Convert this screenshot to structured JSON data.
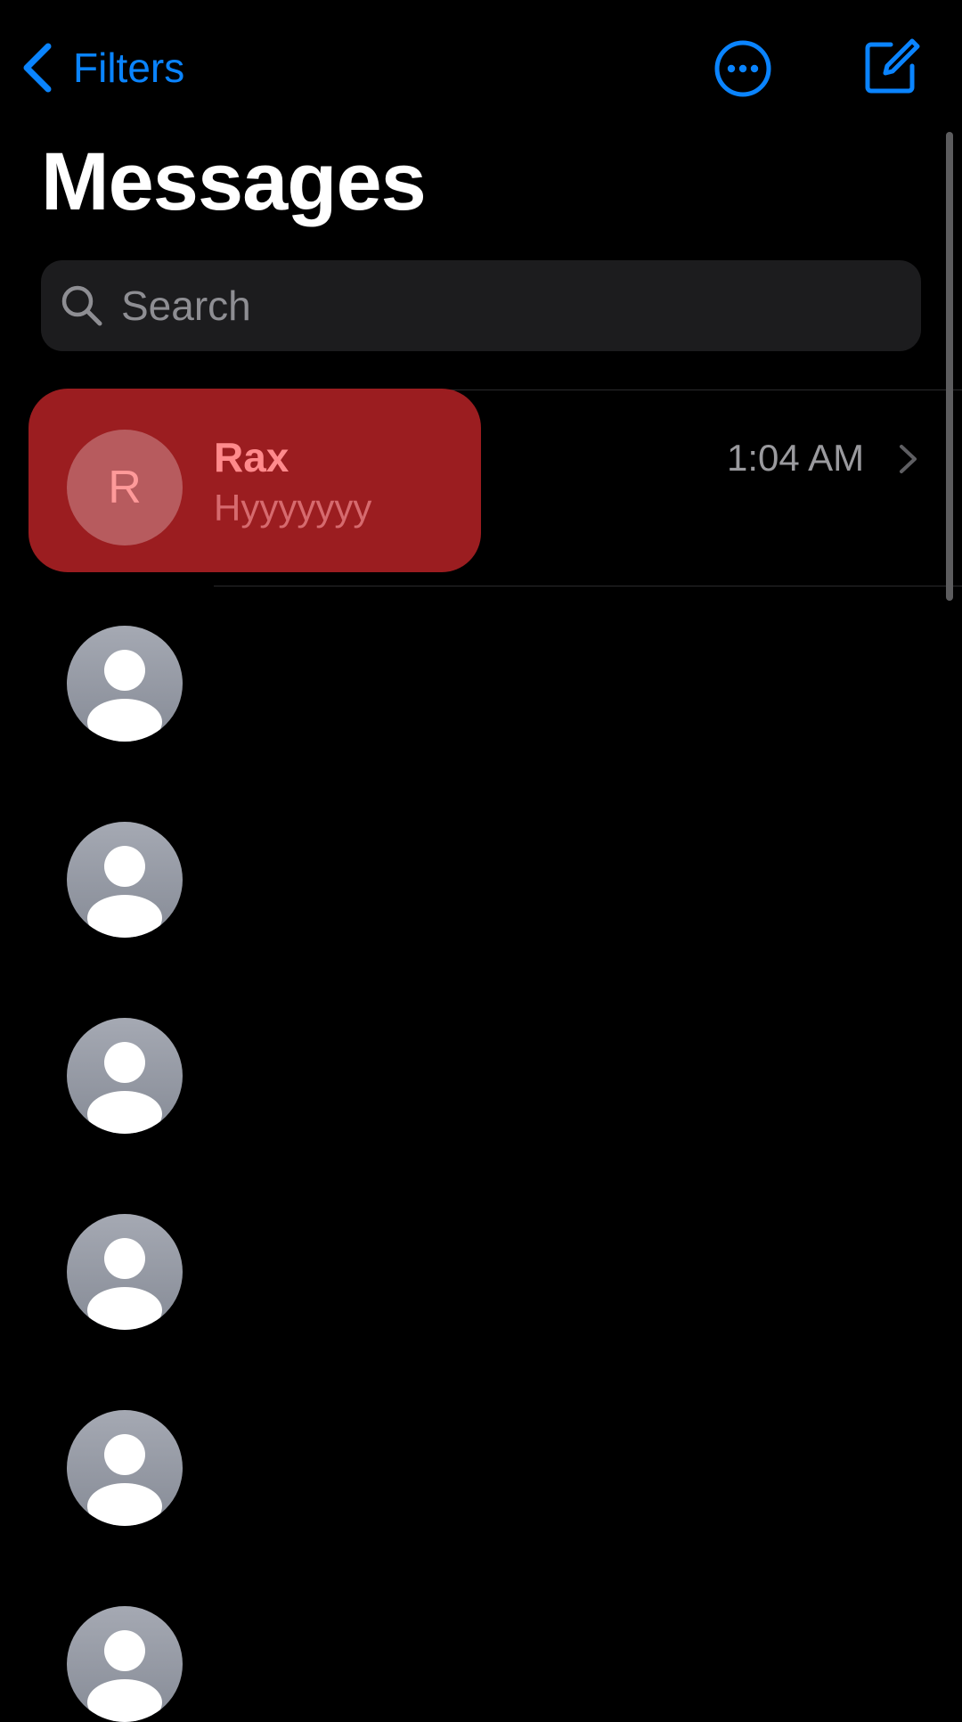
{
  "nav": {
    "back_label": "Filters",
    "more_icon": "ellipsis-circle-icon",
    "compose_icon": "compose-icon"
  },
  "page": {
    "title": "Messages"
  },
  "search": {
    "placeholder": "Search"
  },
  "colors": {
    "accent": "#0a84ff",
    "highlight": "#9b1d20",
    "background": "#000000"
  },
  "conversations": [
    {
      "name": "Rax",
      "initial": "R",
      "preview": "Hyyyyyyy",
      "time": "1:04 AM"
    }
  ]
}
